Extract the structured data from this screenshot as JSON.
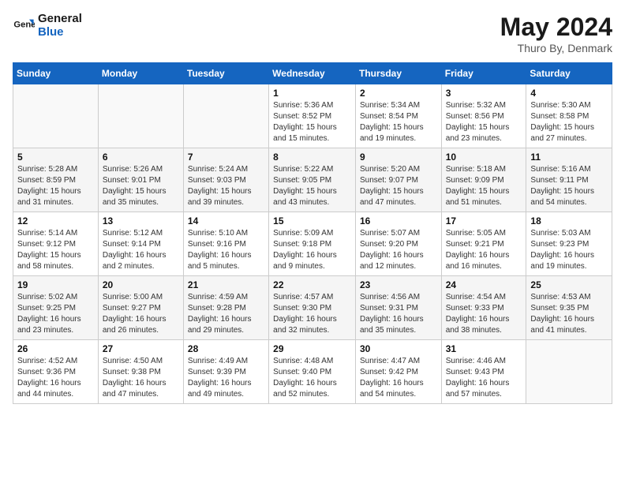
{
  "header": {
    "logo_line1": "General",
    "logo_line2": "Blue",
    "main_title": "May 2024",
    "subtitle": "Thuro By, Denmark"
  },
  "days_of_week": [
    "Sunday",
    "Monday",
    "Tuesday",
    "Wednesday",
    "Thursday",
    "Friday",
    "Saturday"
  ],
  "weeks": [
    [
      {
        "day": "",
        "info": ""
      },
      {
        "day": "",
        "info": ""
      },
      {
        "day": "",
        "info": ""
      },
      {
        "day": "1",
        "info": "Sunrise: 5:36 AM\nSunset: 8:52 PM\nDaylight: 15 hours\nand 15 minutes."
      },
      {
        "day": "2",
        "info": "Sunrise: 5:34 AM\nSunset: 8:54 PM\nDaylight: 15 hours\nand 19 minutes."
      },
      {
        "day": "3",
        "info": "Sunrise: 5:32 AM\nSunset: 8:56 PM\nDaylight: 15 hours\nand 23 minutes."
      },
      {
        "day": "4",
        "info": "Sunrise: 5:30 AM\nSunset: 8:58 PM\nDaylight: 15 hours\nand 27 minutes."
      }
    ],
    [
      {
        "day": "5",
        "info": "Sunrise: 5:28 AM\nSunset: 8:59 PM\nDaylight: 15 hours\nand 31 minutes."
      },
      {
        "day": "6",
        "info": "Sunrise: 5:26 AM\nSunset: 9:01 PM\nDaylight: 15 hours\nand 35 minutes."
      },
      {
        "day": "7",
        "info": "Sunrise: 5:24 AM\nSunset: 9:03 PM\nDaylight: 15 hours\nand 39 minutes."
      },
      {
        "day": "8",
        "info": "Sunrise: 5:22 AM\nSunset: 9:05 PM\nDaylight: 15 hours\nand 43 minutes."
      },
      {
        "day": "9",
        "info": "Sunrise: 5:20 AM\nSunset: 9:07 PM\nDaylight: 15 hours\nand 47 minutes."
      },
      {
        "day": "10",
        "info": "Sunrise: 5:18 AM\nSunset: 9:09 PM\nDaylight: 15 hours\nand 51 minutes."
      },
      {
        "day": "11",
        "info": "Sunrise: 5:16 AM\nSunset: 9:11 PM\nDaylight: 15 hours\nand 54 minutes."
      }
    ],
    [
      {
        "day": "12",
        "info": "Sunrise: 5:14 AM\nSunset: 9:12 PM\nDaylight: 15 hours\nand 58 minutes."
      },
      {
        "day": "13",
        "info": "Sunrise: 5:12 AM\nSunset: 9:14 PM\nDaylight: 16 hours\nand 2 minutes."
      },
      {
        "day": "14",
        "info": "Sunrise: 5:10 AM\nSunset: 9:16 PM\nDaylight: 16 hours\nand 5 minutes."
      },
      {
        "day": "15",
        "info": "Sunrise: 5:09 AM\nSunset: 9:18 PM\nDaylight: 16 hours\nand 9 minutes."
      },
      {
        "day": "16",
        "info": "Sunrise: 5:07 AM\nSunset: 9:20 PM\nDaylight: 16 hours\nand 12 minutes."
      },
      {
        "day": "17",
        "info": "Sunrise: 5:05 AM\nSunset: 9:21 PM\nDaylight: 16 hours\nand 16 minutes."
      },
      {
        "day": "18",
        "info": "Sunrise: 5:03 AM\nSunset: 9:23 PM\nDaylight: 16 hours\nand 19 minutes."
      }
    ],
    [
      {
        "day": "19",
        "info": "Sunrise: 5:02 AM\nSunset: 9:25 PM\nDaylight: 16 hours\nand 23 minutes."
      },
      {
        "day": "20",
        "info": "Sunrise: 5:00 AM\nSunset: 9:27 PM\nDaylight: 16 hours\nand 26 minutes."
      },
      {
        "day": "21",
        "info": "Sunrise: 4:59 AM\nSunset: 9:28 PM\nDaylight: 16 hours\nand 29 minutes."
      },
      {
        "day": "22",
        "info": "Sunrise: 4:57 AM\nSunset: 9:30 PM\nDaylight: 16 hours\nand 32 minutes."
      },
      {
        "day": "23",
        "info": "Sunrise: 4:56 AM\nSunset: 9:31 PM\nDaylight: 16 hours\nand 35 minutes."
      },
      {
        "day": "24",
        "info": "Sunrise: 4:54 AM\nSunset: 9:33 PM\nDaylight: 16 hours\nand 38 minutes."
      },
      {
        "day": "25",
        "info": "Sunrise: 4:53 AM\nSunset: 9:35 PM\nDaylight: 16 hours\nand 41 minutes."
      }
    ],
    [
      {
        "day": "26",
        "info": "Sunrise: 4:52 AM\nSunset: 9:36 PM\nDaylight: 16 hours\nand 44 minutes."
      },
      {
        "day": "27",
        "info": "Sunrise: 4:50 AM\nSunset: 9:38 PM\nDaylight: 16 hours\nand 47 minutes."
      },
      {
        "day": "28",
        "info": "Sunrise: 4:49 AM\nSunset: 9:39 PM\nDaylight: 16 hours\nand 49 minutes."
      },
      {
        "day": "29",
        "info": "Sunrise: 4:48 AM\nSunset: 9:40 PM\nDaylight: 16 hours\nand 52 minutes."
      },
      {
        "day": "30",
        "info": "Sunrise: 4:47 AM\nSunset: 9:42 PM\nDaylight: 16 hours\nand 54 minutes."
      },
      {
        "day": "31",
        "info": "Sunrise: 4:46 AM\nSunset: 9:43 PM\nDaylight: 16 hours\nand 57 minutes."
      },
      {
        "day": "",
        "info": ""
      }
    ]
  ]
}
